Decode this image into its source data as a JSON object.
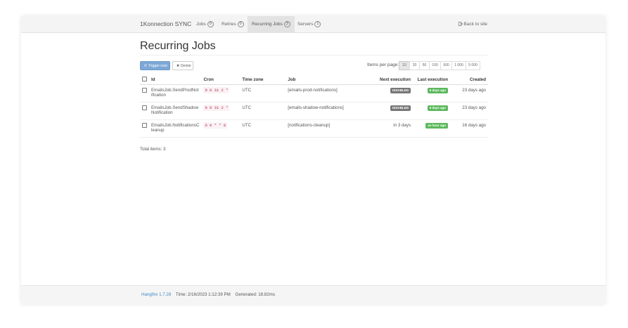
{
  "brand": "1Konnection SYNC",
  "nav": [
    {
      "label": "Jobs",
      "count": "0",
      "active": false
    },
    {
      "label": "Retries",
      "count": "0",
      "active": false
    },
    {
      "label": "Recurring Jobs",
      "count": "3",
      "active": true
    },
    {
      "label": "Servers",
      "count": "1",
      "active": false
    }
  ],
  "back_link": "Back to site",
  "page_title": "Recurring Jobs",
  "toolbar": {
    "trigger_label": "Trigger now",
    "delete_label": "Delete",
    "items_per_page_label": "Items per page:",
    "page_sizes": [
      "10",
      "20",
      "50",
      "100",
      "500",
      "1 000",
      "5 000"
    ],
    "selected_page_size": "10"
  },
  "table": {
    "headers": {
      "id": "Id",
      "cron": "Cron",
      "timezone": "Time zone",
      "job": "Job",
      "next": "Next execution",
      "last": "Last execution",
      "created": "Created"
    },
    "rows": [
      {
        "id": "EmailsJob.SendProdNotification",
        "id_line1": "EmailsJob.SendProdNot",
        "id_line2": "ification",
        "cron": "0 0 31 2 *",
        "timezone": "UTC",
        "job": "[emails-prod-notifications]",
        "next": "DISABLED",
        "last": "6 days ago",
        "created": "23 days ago"
      },
      {
        "id": "EmailsJob.SendShadowNotification",
        "id_line1": "EmailsJob.SendShadow",
        "id_line2": "Notification",
        "cron": "0 0 31 2 *",
        "timezone": "UTC",
        "job": "[emails-shadow-notifications]",
        "next": "DISABLED",
        "last": "6 days ago",
        "created": "23 days ago"
      },
      {
        "id": "EmailsJob.NotificationsCleanup",
        "id_line1": "EmailsJob.NotificationsC",
        "id_line2": "leanup",
        "cron": "0 0 * * 0",
        "timezone": "UTC",
        "job": "[notifications-cleanup]",
        "next": "in 3 days",
        "last": "an hour ago",
        "created": "16 days ago"
      }
    ]
  },
  "total_items": "Total items: 3",
  "footer": {
    "hangfire": "Hangfire 1.7.28",
    "time": "Time: 2/16/2023 1:12:39 PM",
    "generated": "Generated: 18.82ms"
  },
  "colors": {
    "primary": "#7da8d6",
    "success": "#5cb85c",
    "disabled": "#777777",
    "link": "#428bca"
  }
}
